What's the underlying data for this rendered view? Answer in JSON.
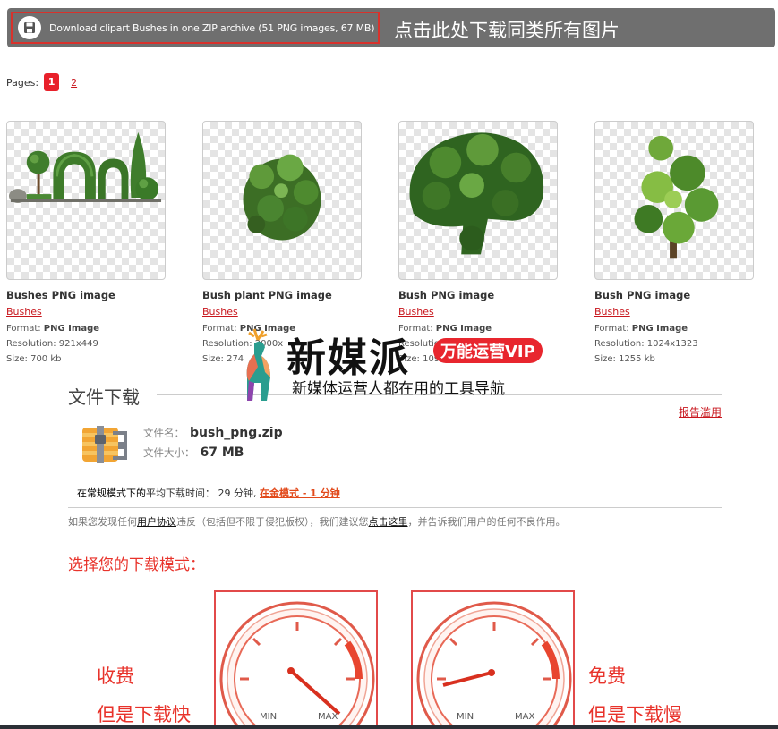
{
  "zip": {
    "label": "Download clipart Bushes in one ZIP archive (51 PNG images, 67 MB)",
    "annotation": "点击此处下载同类所有图片",
    "icon": "disk-icon"
  },
  "pagination": {
    "label": "Pages:",
    "current": "1",
    "next": "2"
  },
  "cards": [
    {
      "title": "Bushes PNG image",
      "category": "Bushes",
      "format_label": "Format:",
      "format_value": "PNG Image",
      "resolution": "Resolution: 921x449",
      "size": "Size: 700 kb"
    },
    {
      "title": "Bush plant PNG image",
      "category": "Bushes",
      "format_label": "Format:",
      "format_value": "PNG Image",
      "resolution": "Resolution: 2000x",
      "size": "Size: 274"
    },
    {
      "title": "Bush PNG image",
      "category": "Bushes",
      "format_label": "Format:",
      "format_value": "PNG Image",
      "resolution": "Resolution:",
      "size": "Size: 1097 kb"
    },
    {
      "title": "Bush PNG image",
      "category": "Bushes",
      "format_label": "Format:",
      "format_value": "PNG Image",
      "resolution": "Resolution: 1024x1323",
      "size": "Size: 1255 kb"
    }
  ],
  "watermark": {
    "brand": "新媒派",
    "badge": "万能运营VIP",
    "slogan": "新媒体运营人都在用的工具导航"
  },
  "download": {
    "heading": "文件下载",
    "report": "报告滥用",
    "filename_label": "文件名：",
    "filename": "bush_png.zip",
    "filesize_label": "文件大小：",
    "filesize": "67 MB",
    "timing_prefix": "在常规模式下的",
    "timing_middle": "平均下载时间： 29 分钟,",
    "timing_link": "在金模式 - 1 分钟",
    "notice_before": "如果您发现任何",
    "notice_link1": "用户协议",
    "notice_middle": "违反（包括但不限于侵犯版权），我们建议您",
    "notice_link2": "点击这里",
    "notice_after": "，并告诉我们用户的任何不良作用。",
    "mode_heading": "选择您的下载模式："
  },
  "modes": {
    "paid_line1": "收费",
    "paid_line2": "但是下载快",
    "free_line1": "免费",
    "free_line2": "但是下载慢",
    "min_label": "MIN",
    "max_label": "MAX"
  },
  "colors": {
    "accent": "#e8332b",
    "link": "#c8161d",
    "bar": "#6f6f6f",
    "gold": "#e24a1b"
  }
}
